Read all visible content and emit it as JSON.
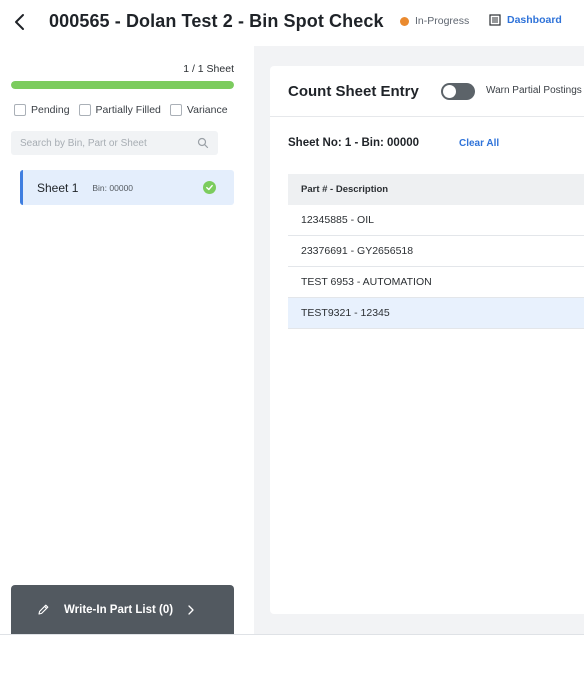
{
  "header": {
    "title": "000565 - Dolan Test 2 - Bin Spot Check",
    "status_label": "In-Progress",
    "status_color": "#ea8a2f",
    "dashboard_label": "Dashboard",
    "back_icon": "chevron-left-icon",
    "dashboard_icon": "document-list-icon"
  },
  "sidebar": {
    "sheet_count": "1 / 1 Sheet",
    "progress_fraction": 1.0,
    "progress_color": "#7ccc5e",
    "filters": [
      {
        "label": "Pending"
      },
      {
        "label": "Partially Filled"
      },
      {
        "label": "Variance"
      }
    ],
    "search_placeholder": "Search by Bin, Part or Sheet",
    "sheets": [
      {
        "name": "Sheet 1",
        "bin": "Bin: 00000",
        "completed": true
      }
    ],
    "write_in_label": "Write-In Part List (0)"
  },
  "main": {
    "title": "Count Sheet Entry",
    "warn_toggle_label": "Warn Partial Postings",
    "warn_toggle_on": false,
    "sheet_info": "Sheet No: 1 - Bin: 00000",
    "clear_all_label": "Clear All",
    "table": {
      "header": "Part # - Description",
      "rows": [
        {
          "text": "12345885 - OIL",
          "selected": false
        },
        {
          "text": "23376691 - GY2656518",
          "selected": false
        },
        {
          "text": "TEST 6953 - AUTOMATION",
          "selected": false
        },
        {
          "text": "TEST9321 - 12345",
          "selected": true
        }
      ]
    }
  },
  "colors": {
    "accent": "#2f73d9",
    "selected_bg": "#e4eefc"
  }
}
